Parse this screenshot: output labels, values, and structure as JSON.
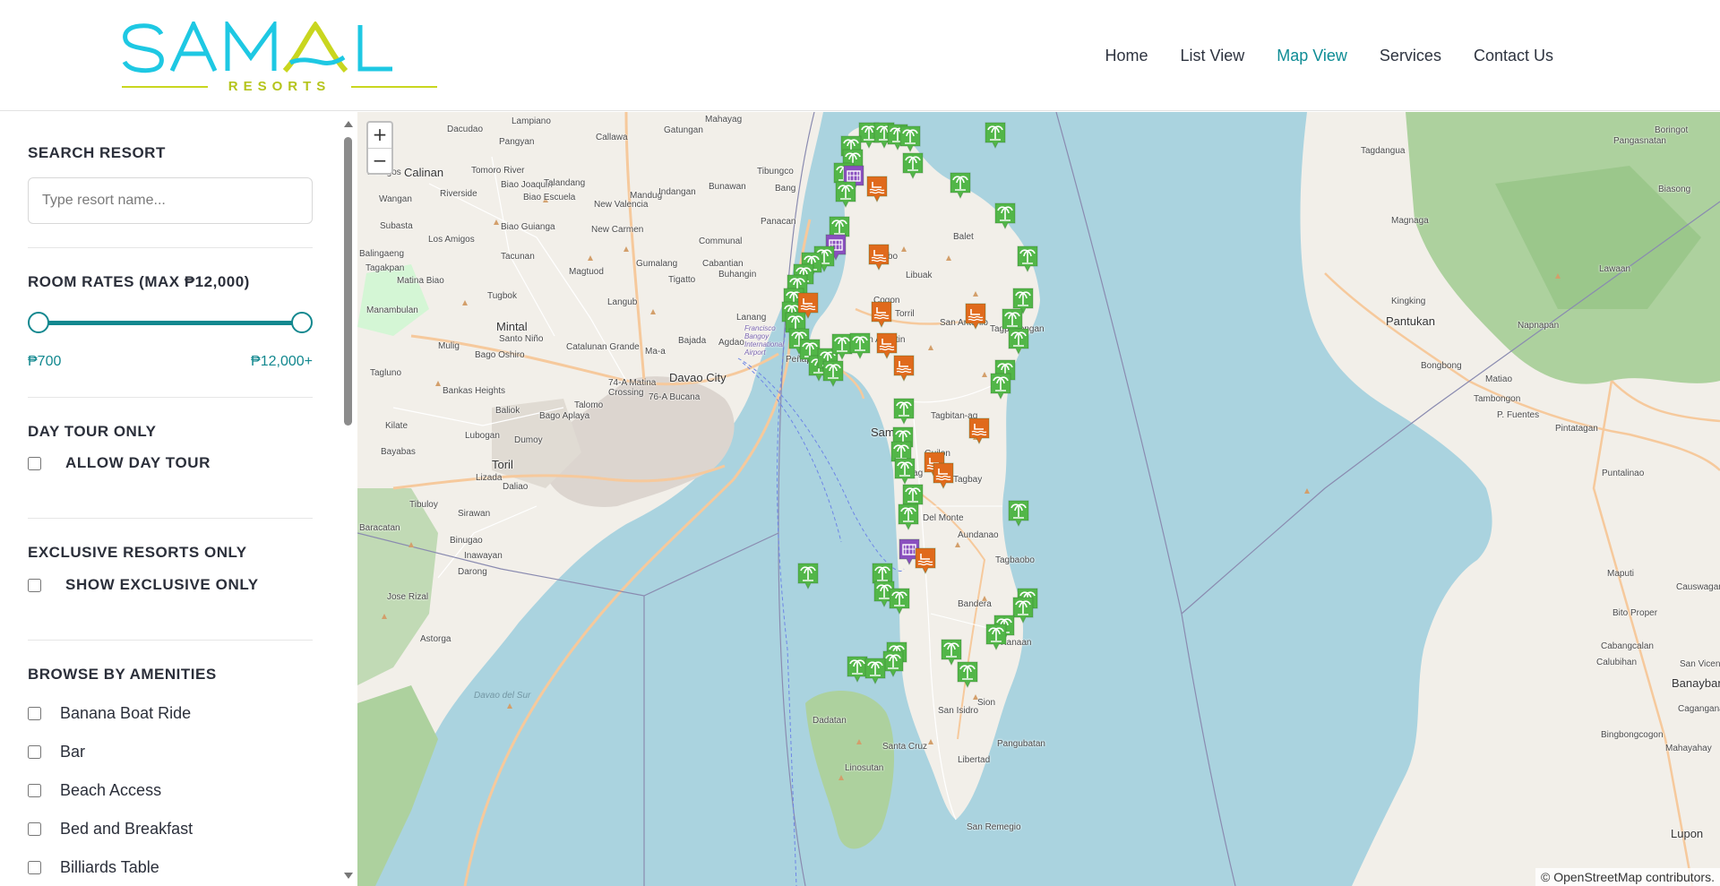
{
  "brand": {
    "name": "SAMAL",
    "name_a": "A",
    "subtitle": "RESORTS"
  },
  "nav": [
    {
      "label": "Home",
      "active": false
    },
    {
      "label": "List View",
      "active": false
    },
    {
      "label": "Map View",
      "active": true
    },
    {
      "label": "Services",
      "active": false
    },
    {
      "label": "Contact Us",
      "active": false
    }
  ],
  "sidebar": {
    "search": {
      "title": "SEARCH RESORT",
      "placeholder": "Type resort name..."
    },
    "rates": {
      "title": "ROOM RATES (MAX ₱12,000)",
      "min_label": "₱700",
      "max_label": "₱12,000+"
    },
    "day_tour": {
      "title": "DAY TOUR ONLY",
      "option": "ALLOW DAY TOUR",
      "checked": false
    },
    "exclusive": {
      "title": "EXCLUSIVE RESORTS ONLY",
      "option": "SHOW EXCLUSIVE ONLY",
      "checked": false
    },
    "amenities": {
      "title": "BROWSE BY AMENITIES",
      "items": [
        "Banana Boat Ride",
        "Bar",
        "Beach Access",
        "Bed and Breakfast",
        "Billiards Table"
      ]
    }
  },
  "map": {
    "zoom_in": "+",
    "zoom_out": "−",
    "attribution_prefix": "© ",
    "attribution_link": "OpenStreetMap",
    "attribution_suffix": " contributors.",
    "places": [
      "Lampiano",
      "Mahayag",
      "Dacudao",
      "Callawa",
      "Gatungan",
      "Pangyan",
      "Calinan",
      "Malagos",
      "Tomoro River",
      "Biao Joaquin",
      "Talandang",
      "Tibungco",
      "Bunawan",
      "Bang",
      "Wangan",
      "Riverside",
      "Biao Escuela",
      "New Valencia",
      "Mandug",
      "Indangan",
      "Panacan",
      "Biao Guianga",
      "Subasta",
      "Los Amigos",
      "New Carmen",
      "Communal",
      "Balingaeng",
      "Tacunan",
      "Magtuod",
      "Gumalang",
      "Cabantian",
      "Tagakpan",
      "Matina Biao",
      "Tigatto",
      "Buhangin",
      "Tugbok",
      "Langub",
      "Lanang",
      "Manambulan",
      "Mintal",
      "Santo Niño",
      "Bajada",
      "Agdao",
      "Mulig",
      "Bago Oshiro",
      "Catalunan Grande",
      "Ma-a",
      "Tagluno",
      "Davao City",
      "74-A Matina Crossing",
      "76-A Bucana",
      "Bankas Heights",
      "Baliok",
      "Talomo",
      "Bago Aplaya",
      "Kilate",
      "Lubogan",
      "Dumoy",
      "Bayabas",
      "Toril",
      "Lizada",
      "Daliao",
      "Tibuloy",
      "Sirawan",
      "Baracatan",
      "Binugao",
      "Inawayan",
      "Darong",
      "Jose Rizal",
      "Astorga",
      "Davao del Sur",
      "Peñaplata",
      "Tambo",
      "Cogon",
      "Libuak",
      "Balet",
      "Tagpopongan",
      "Torril",
      "San Agustin",
      "San Antonio",
      "Samal",
      "Tagbitan-ag",
      "Guilon",
      "Cawag",
      "Tagbay",
      "Del Monte",
      "Aundanao",
      "Tagbaobo",
      "Bandera",
      "Kanaan",
      "Sion",
      "San Isidro",
      "Dadatan",
      "Santa Cruz",
      "Linosutan",
      "Libertad",
      "Pangubatan",
      "San Remegio",
      "Tagdangua",
      "Pangasnatan",
      "Boringot",
      "Magnaga",
      "Biasong",
      "Lawaan",
      "Kingking",
      "Pantukan",
      "Napnapan",
      "Bongbong",
      "Matiao",
      "Tambongon",
      "P. Fuentes",
      "Pintatagan",
      "Puntalinao",
      "Maputi",
      "Causwagan",
      "Bito Proper",
      "Cabangcalan",
      "Calubihan",
      "San Vicente",
      "Banaybanay",
      "Caganganan",
      "Mahayahay",
      "Bingbongcogon",
      "Lupon",
      "Francisco Bangoy International Airport"
    ]
  }
}
